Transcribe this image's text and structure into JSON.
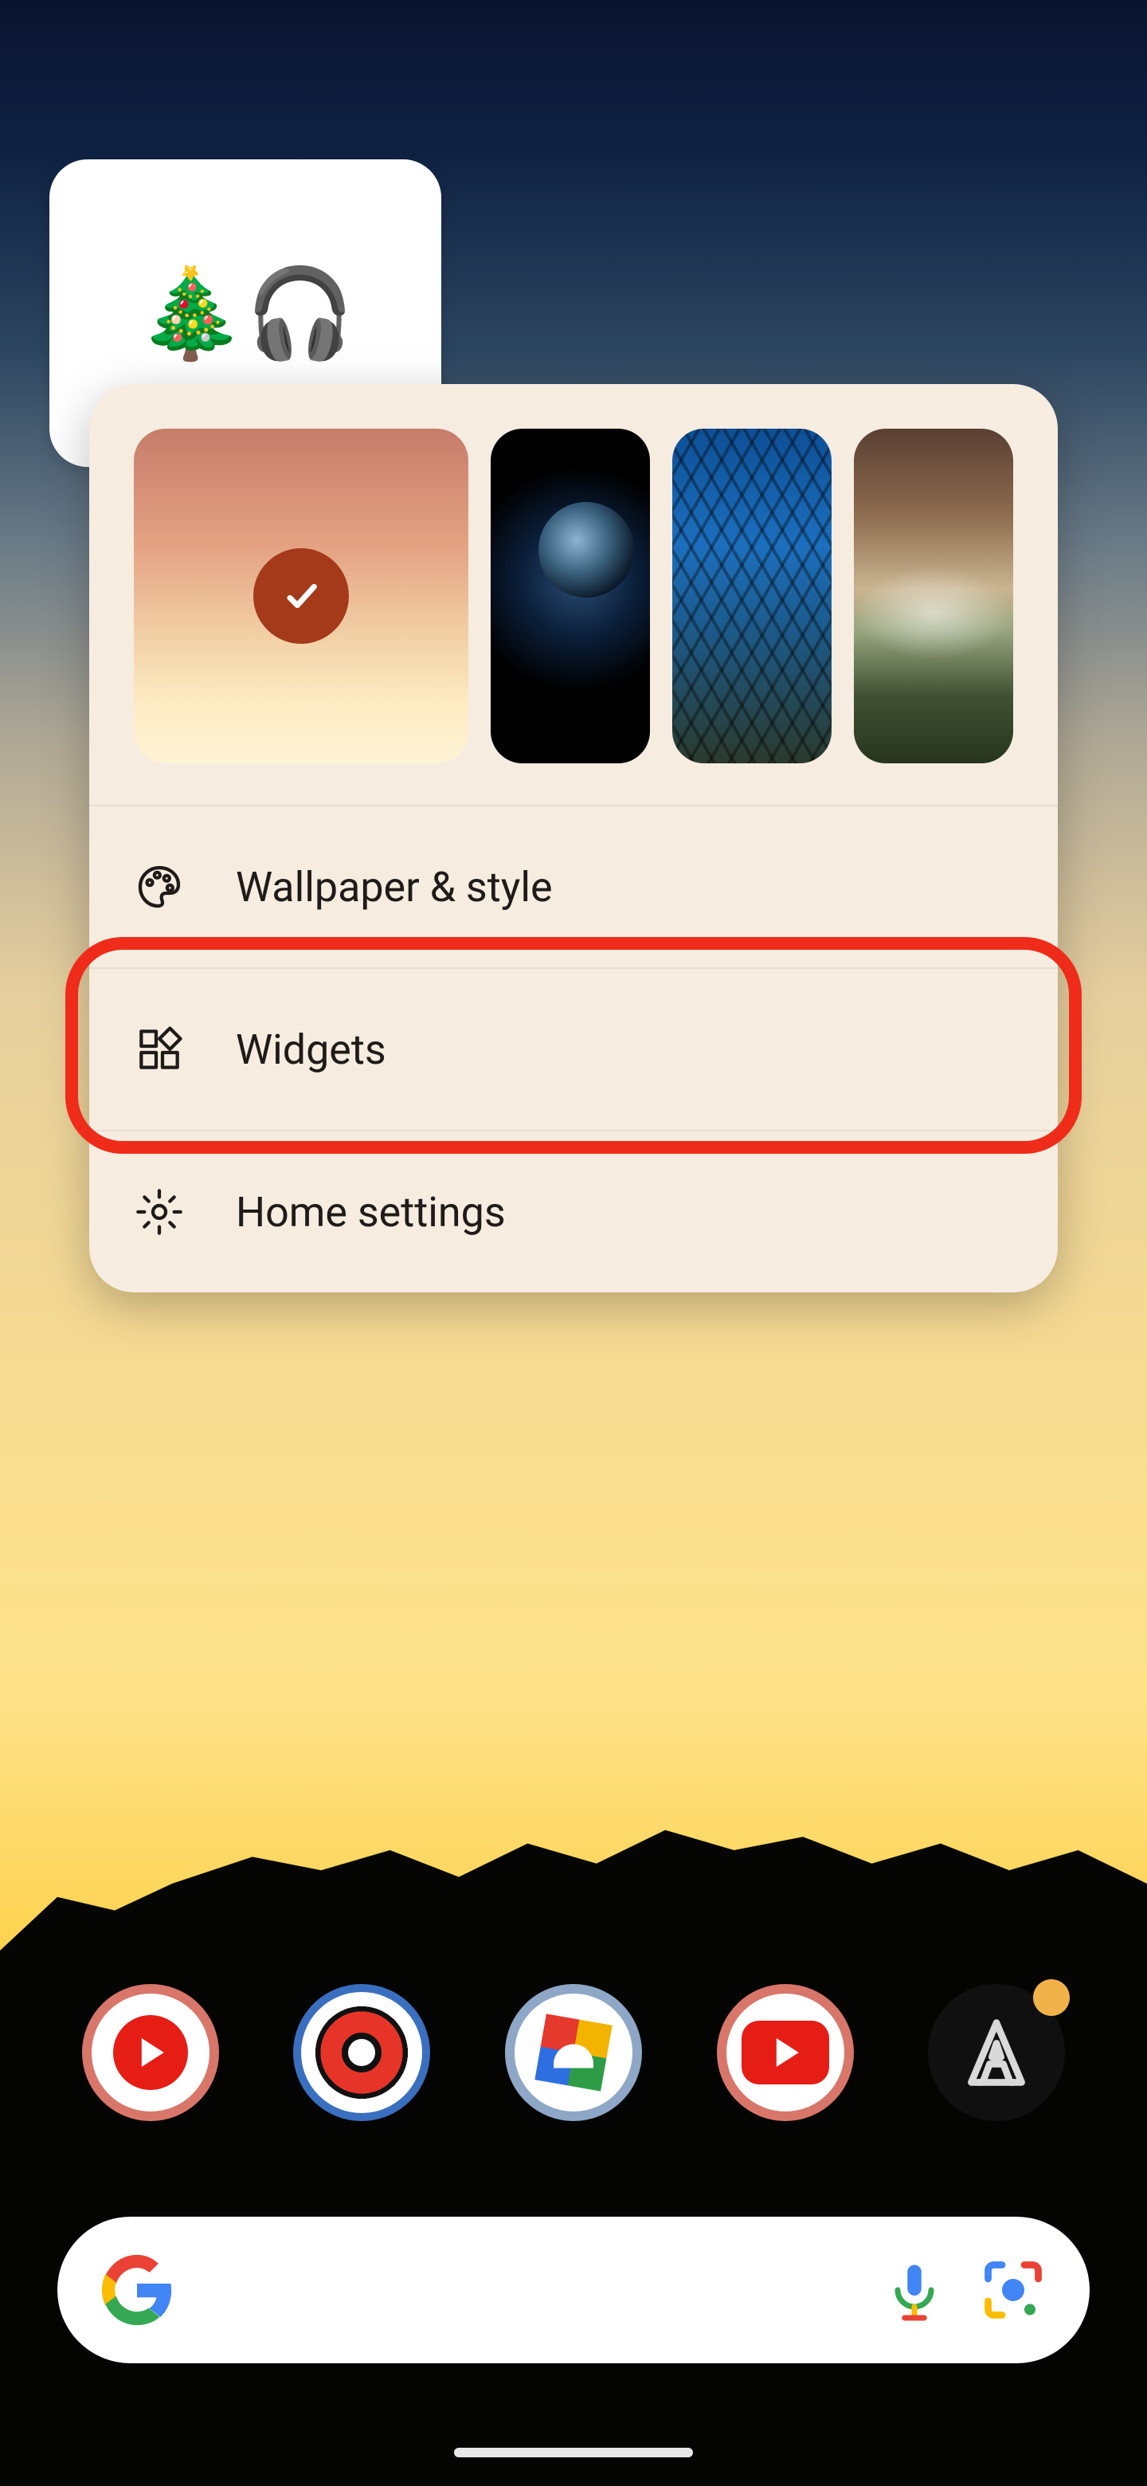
{
  "widget_card": {
    "emoji_text": "🎄🎧"
  },
  "popup": {
    "wallpapers": [
      {
        "name": "current-gradient",
        "selected": true
      },
      {
        "name": "earth"
      },
      {
        "name": "steel-structure"
      },
      {
        "name": "foggy-forest"
      }
    ],
    "menu": {
      "wallpaper_label": "Wallpaper & style",
      "widgets_label": "Widgets",
      "home_settings_label": "Home settings"
    }
  },
  "annotation": {
    "highlighted_item": "widgets"
  },
  "dock": {
    "apps": [
      {
        "name": "youtube-music"
      },
      {
        "name": "pokemon-go"
      },
      {
        "name": "family-link"
      },
      {
        "name": "youtube"
      },
      {
        "name": "atlas-app",
        "has_notification": true
      }
    ]
  },
  "search": {
    "placeholder": ""
  }
}
